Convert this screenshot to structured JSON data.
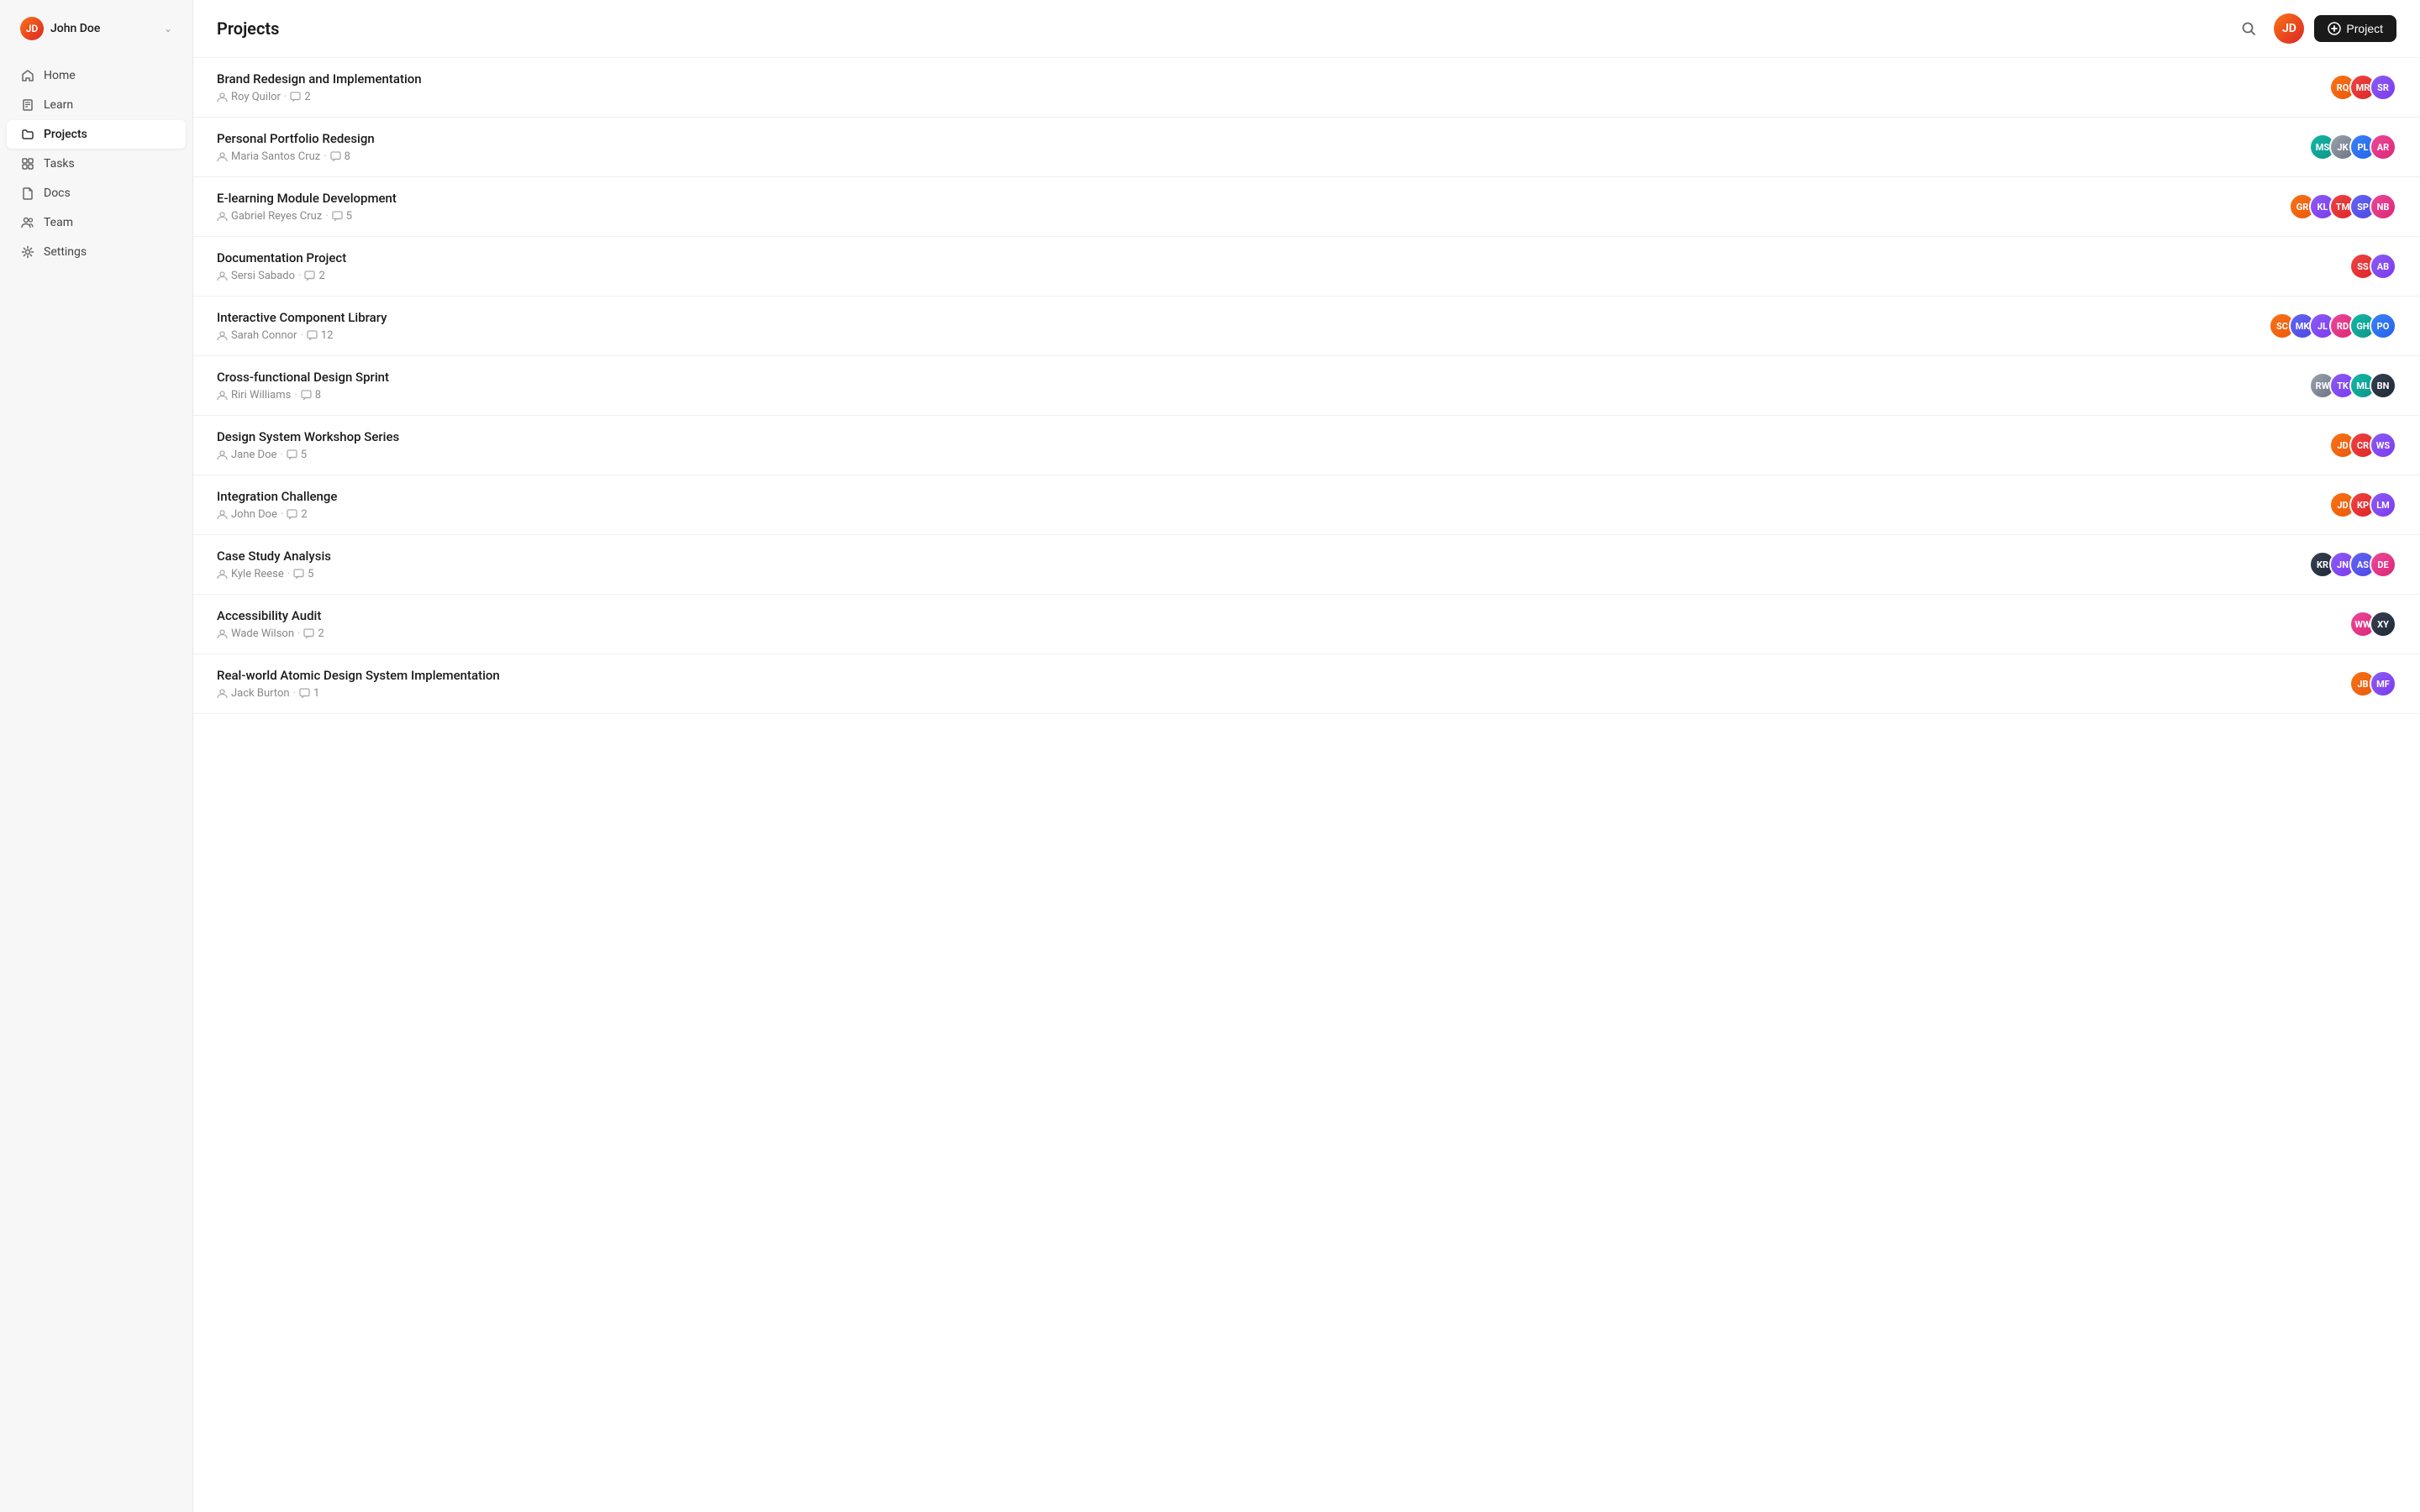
{
  "sidebar": {
    "user": {
      "name": "John Doe",
      "initials": "JD"
    },
    "nav_items": [
      {
        "id": "home",
        "label": "Home",
        "icon": "home",
        "active": false
      },
      {
        "id": "learn",
        "label": "Learn",
        "icon": "book",
        "active": false
      },
      {
        "id": "projects",
        "label": "Projects",
        "icon": "folder",
        "active": true
      },
      {
        "id": "tasks",
        "label": "Tasks",
        "icon": "grid",
        "active": false
      },
      {
        "id": "docs",
        "label": "Docs",
        "icon": "file",
        "active": false
      },
      {
        "id": "team",
        "label": "Team",
        "icon": "users",
        "active": false
      },
      {
        "id": "settings",
        "label": "Settings",
        "icon": "gear",
        "active": false
      }
    ]
  },
  "header": {
    "title": "Projects",
    "new_project_label": "Project"
  },
  "projects": [
    {
      "id": 1,
      "name": "Brand Redesign and Implementation",
      "owner": "Roy Quilor",
      "comments": 2,
      "avatars": [
        {
          "color": "av-orange",
          "initials": "RQ"
        },
        {
          "color": "av-red",
          "initials": "MR"
        },
        {
          "color": "av-purple",
          "initials": "SR"
        }
      ]
    },
    {
      "id": 2,
      "name": "Personal Portfolio Redesign",
      "owner": "Maria Santos Cruz",
      "comments": 8,
      "avatars": [
        {
          "color": "av-teal",
          "initials": "MS"
        },
        {
          "color": "av-gray",
          "initials": "JK"
        },
        {
          "color": "av-blue",
          "initials": "PL"
        },
        {
          "color": "av-pink",
          "initials": "AR"
        }
      ]
    },
    {
      "id": 3,
      "name": "E-learning Module Development",
      "owner": "Gabriel Reyes Cruz",
      "comments": 5,
      "avatars": [
        {
          "color": "av-orange",
          "initials": "GR"
        },
        {
          "color": "av-purple",
          "initials": "KL"
        },
        {
          "color": "av-red",
          "initials": "TM"
        },
        {
          "color": "av-indigo",
          "initials": "SP"
        },
        {
          "color": "av-pink",
          "initials": "NB"
        }
      ]
    },
    {
      "id": 4,
      "name": "Documentation Project",
      "owner": "Sersi Sabado",
      "comments": 2,
      "avatars": [
        {
          "color": "av-red",
          "initials": "SS"
        },
        {
          "color": "av-purple",
          "initials": "AB"
        }
      ]
    },
    {
      "id": 5,
      "name": "Interactive Component Library",
      "owner": "Sarah Connor",
      "comments": 12,
      "avatars": [
        {
          "color": "av-orange",
          "initials": "SC"
        },
        {
          "color": "av-indigo",
          "initials": "MK"
        },
        {
          "color": "av-purple",
          "initials": "JL"
        },
        {
          "color": "av-pink",
          "initials": "RD"
        },
        {
          "color": "av-teal",
          "initials": "GH"
        },
        {
          "color": "av-blue",
          "initials": "PO"
        }
      ]
    },
    {
      "id": 6,
      "name": "Cross-functional Design Sprint",
      "owner": "Riri Williams",
      "comments": 8,
      "avatars": [
        {
          "color": "av-gray",
          "initials": "RW"
        },
        {
          "color": "av-purple",
          "initials": "TK"
        },
        {
          "color": "av-teal",
          "initials": "ML"
        },
        {
          "color": "av-dark",
          "initials": "BN"
        }
      ]
    },
    {
      "id": 7,
      "name": "Design System Workshop Series",
      "owner": "Jane Doe",
      "comments": 5,
      "avatars": [
        {
          "color": "av-orange",
          "initials": "JD"
        },
        {
          "color": "av-red",
          "initials": "CR"
        },
        {
          "color": "av-purple",
          "initials": "WS"
        }
      ]
    },
    {
      "id": 8,
      "name": "Integration Challenge",
      "owner": "John Doe",
      "comments": 2,
      "avatars": [
        {
          "color": "av-orange",
          "initials": "JD"
        },
        {
          "color": "av-red",
          "initials": "KP"
        },
        {
          "color": "av-purple",
          "initials": "LM"
        }
      ]
    },
    {
      "id": 9,
      "name": "Case Study Analysis",
      "owner": "Kyle Reese",
      "comments": 5,
      "avatars": [
        {
          "color": "av-dark",
          "initials": "KR"
        },
        {
          "color": "av-purple",
          "initials": "JN"
        },
        {
          "color": "av-indigo",
          "initials": "AS"
        },
        {
          "color": "av-pink",
          "initials": "DE"
        }
      ]
    },
    {
      "id": 10,
      "name": "Accessibility Audit",
      "owner": "Wade Wilson",
      "comments": 2,
      "avatars": [
        {
          "color": "av-pink",
          "initials": "WW"
        },
        {
          "color": "av-dark",
          "initials": "XY"
        }
      ]
    },
    {
      "id": 11,
      "name": "Real-world Atomic Design System Implementation",
      "owner": "Jack Burton",
      "comments": 1,
      "avatars": [
        {
          "color": "av-orange",
          "initials": "JB"
        },
        {
          "color": "av-purple",
          "initials": "MF"
        }
      ]
    }
  ]
}
